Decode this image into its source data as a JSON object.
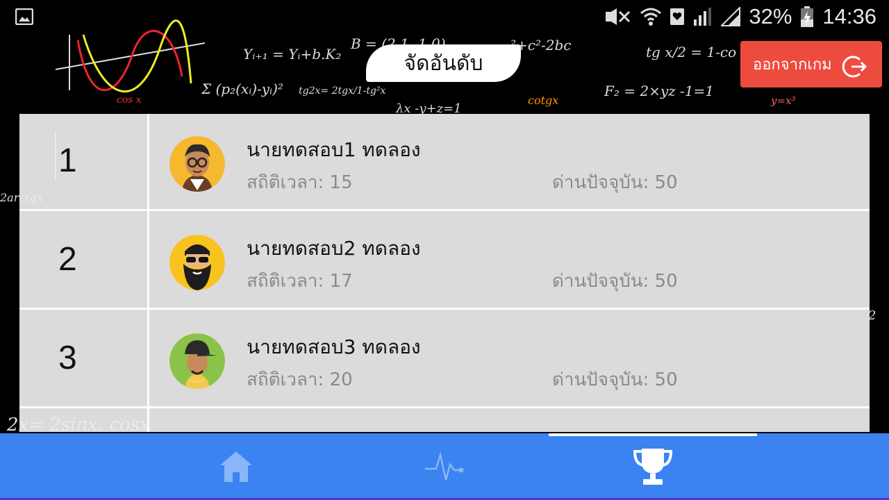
{
  "status_bar": {
    "battery_percent": "32%",
    "time": "14:36",
    "icons": [
      "gallery-icon",
      "mute-icon",
      "wifi-icon",
      "heart-icon",
      "signal-icon",
      "signal-icon",
      "battery-charging-icon"
    ]
  },
  "header": {
    "title": "จัดอันดับ",
    "exit_button_label": "ออกจากเกม",
    "exit_icon": "exit-arrow-icon"
  },
  "leaderboard": {
    "rows": [
      {
        "rank": "1",
        "name": "นายทดสอบ1 ทดลอง",
        "time_stat": "สถิติเวลา: 15",
        "current_stage": "ด่านปัจจุบัน: 50",
        "avatar": "glasses-man-avatar"
      },
      {
        "rank": "2",
        "name": "นายทดสอบ2 ทดลอง",
        "time_stat": "สถิติเวลา: 17",
        "current_stage": "ด่านปัจจุบัน: 50",
        "avatar": "bearded-man-avatar"
      },
      {
        "rank": "3",
        "name": "นายทดสอบ3 ทดลอง",
        "time_stat": "สถิติเวลา: 20",
        "current_stage": "ด่านปัจจุบัน: 50",
        "avatar": "cap-man-avatar"
      }
    ]
  },
  "bottom_nav": {
    "items": [
      {
        "icon": "home-icon",
        "active": false
      },
      {
        "icon": "pulse-icon",
        "active": false
      },
      {
        "icon": "trophy-icon",
        "active": true
      }
    ]
  },
  "colors": {
    "accent_blue": "#3a83f1",
    "exit_red": "#ee4b3f",
    "panel_gray": "#ececec"
  }
}
